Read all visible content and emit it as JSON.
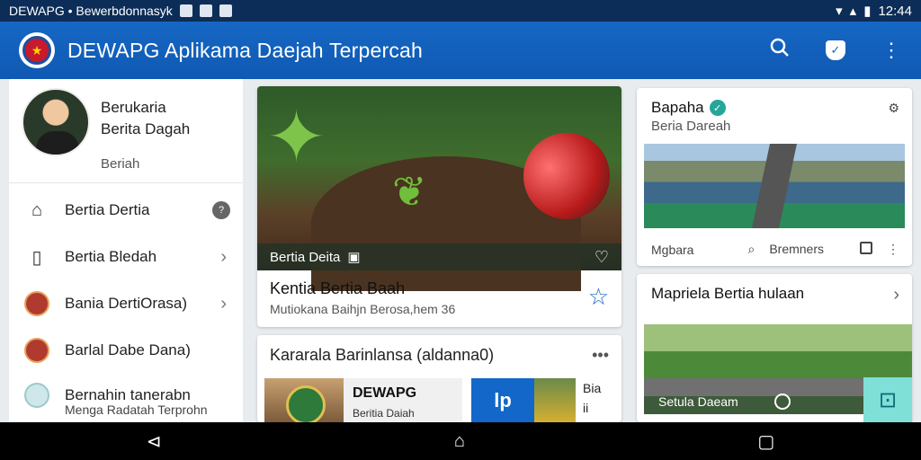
{
  "status": {
    "left_text": "DEWAPG • Bewerbdonnasyk",
    "time": "12:44"
  },
  "appbar": {
    "title": "DEWAPG Aplikama Daejah Terpercah"
  },
  "sidebar": {
    "profile": {
      "name_line1": "Berukaria",
      "name_line2": "Berita Dagah",
      "role": "Beriah"
    },
    "items": [
      {
        "label": "Bertia Dertia",
        "icon": "briefcase-icon",
        "trail": "info"
      },
      {
        "label": "Bertia Bledah",
        "icon": "document-icon",
        "trail": "chevron"
      },
      {
        "label": "Bania DertiOrasa)",
        "icon": "emblem-icon",
        "trail": "chevron"
      },
      {
        "label": "Barlal Dabe Dana)",
        "icon": "emblem-icon",
        "trail": "none"
      },
      {
        "label": "Bernahin tanerabn",
        "sub": "Menga Radatah Terprohn",
        "icon": "emblem-icon",
        "trail": "none"
      }
    ]
  },
  "hero": {
    "band_label": "Bertia Deita",
    "title": "Kentia Bertia Baah",
    "subtitle": "Mutiokana Baihjn Berosa,hem 36"
  },
  "card2": {
    "header": "Kararala Barinlansa (aldanna0)",
    "tile_title": "DEWAPG",
    "tile_sub": "Beritia Daiah",
    "tile_blue": "lp",
    "tile_side_1": "Bia",
    "tile_side_2": "ii"
  },
  "right_card1": {
    "title": "Bapaha",
    "subtitle": "Beria Dareah",
    "foot_left": "Mgbara",
    "foot_mid": "Bremners"
  },
  "right_card2": {
    "title": "Mapriela Bertia hulaan",
    "band_label": "Setula Daeam"
  },
  "colors": {
    "appbar": "#1667c4",
    "statusbar": "#0c2d57",
    "accent_star": "#1667c4",
    "fab": "#7ee0d6"
  }
}
